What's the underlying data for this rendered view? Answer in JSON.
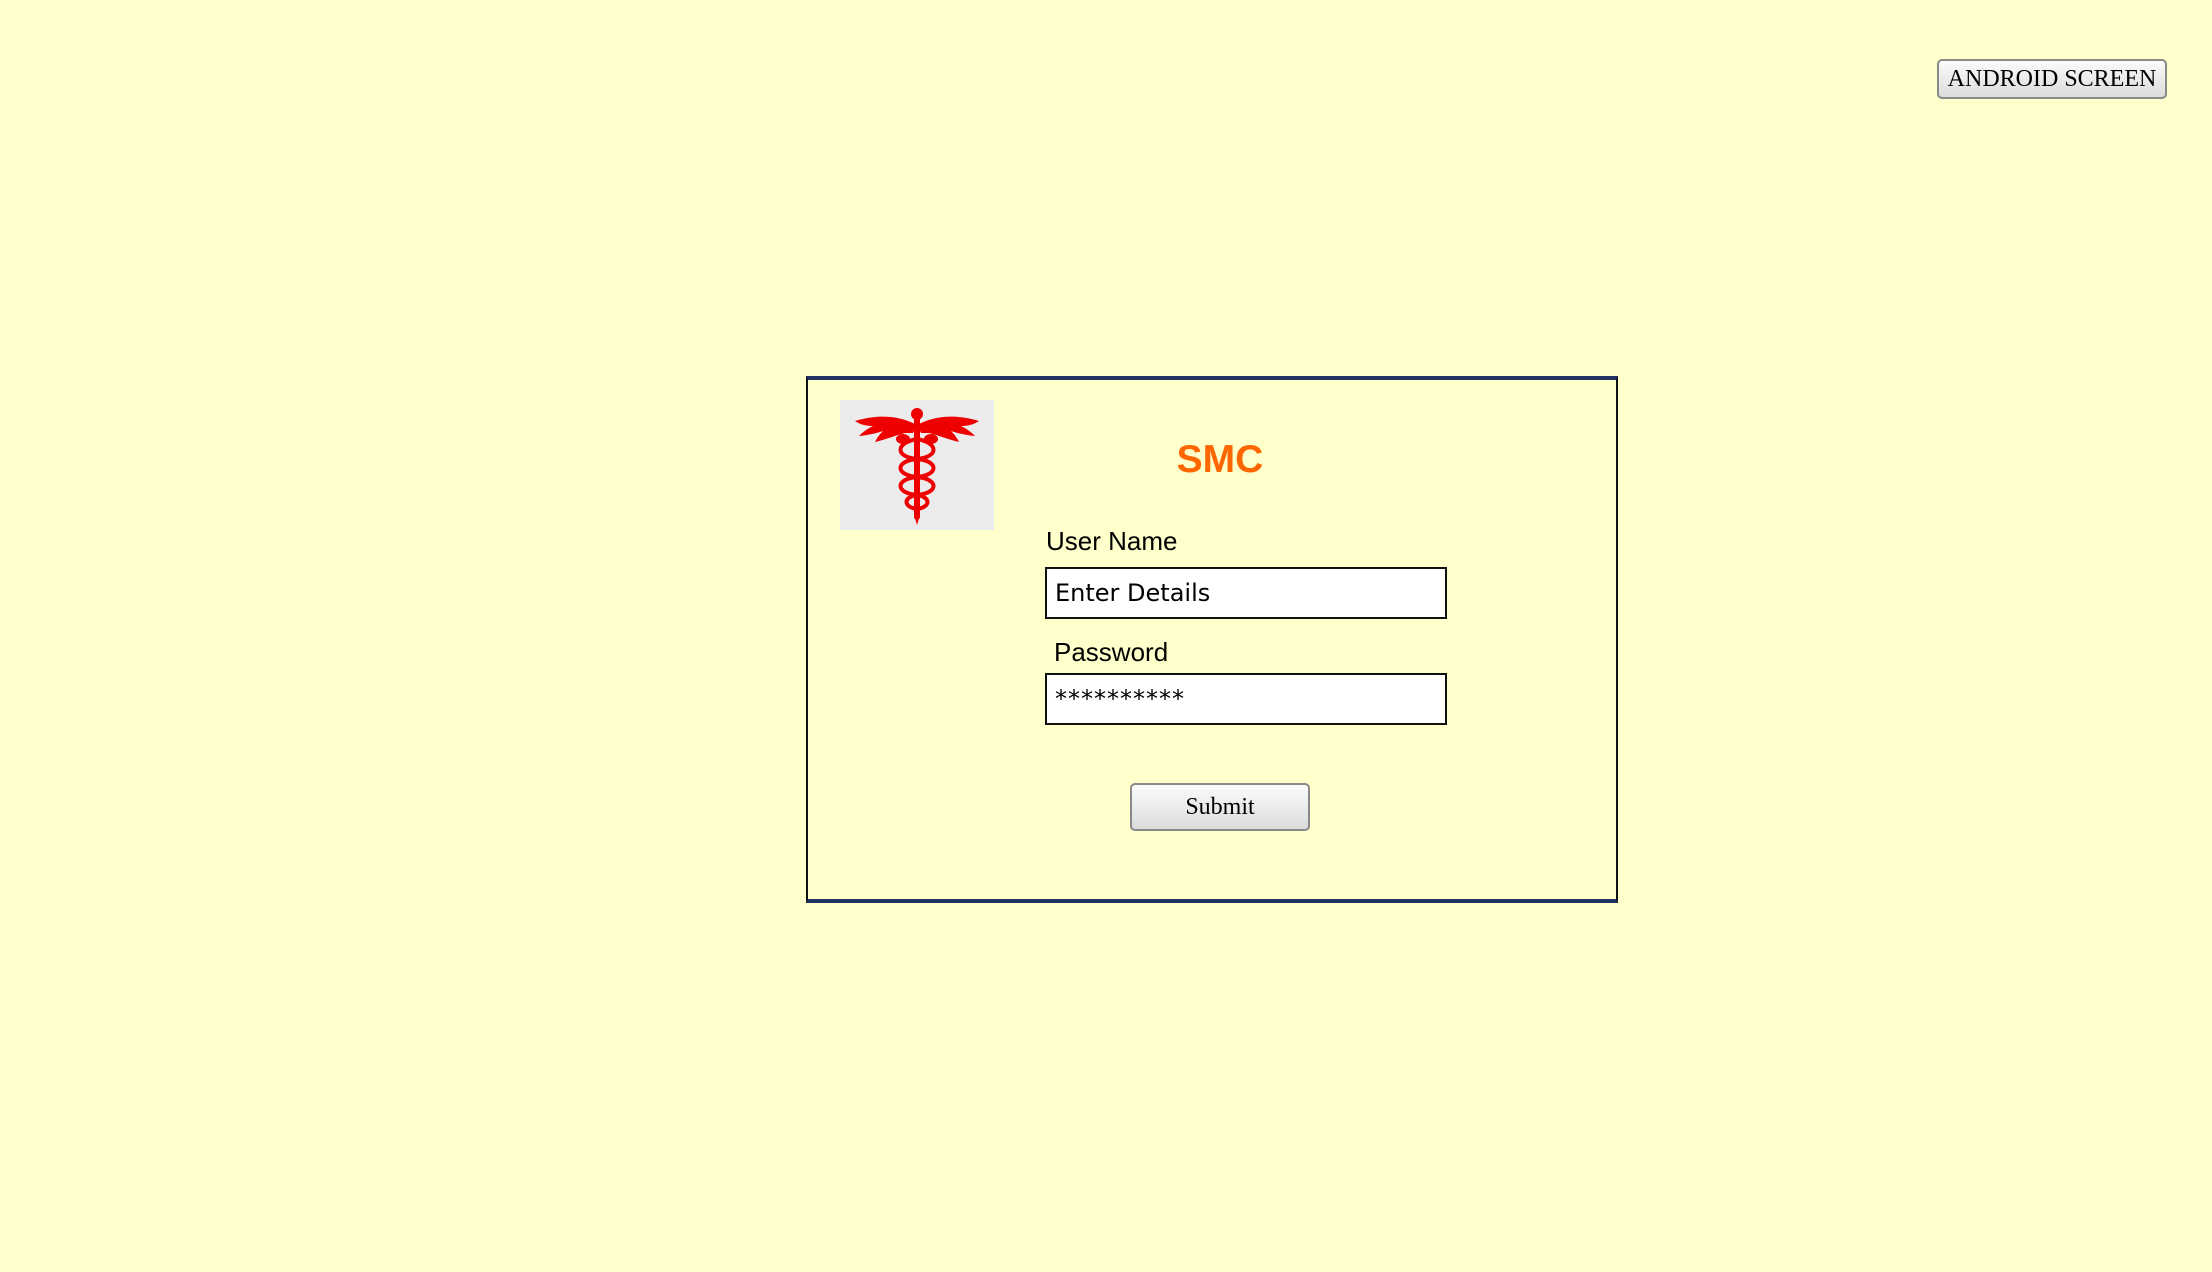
{
  "header": {
    "android_button_label": "ANDROID SCREEN"
  },
  "login": {
    "logo_icon": "caduceus-icon",
    "title": "SMC",
    "title_color": "#ff6600",
    "logo_color": "#ee0000",
    "username_label": "User Name",
    "username_value": "Enter Details",
    "password_label": "Password",
    "password_value": "**********",
    "submit_label": "Submit"
  },
  "theme": {
    "background": "#ffffcc",
    "frame_border": "#1f3163"
  }
}
